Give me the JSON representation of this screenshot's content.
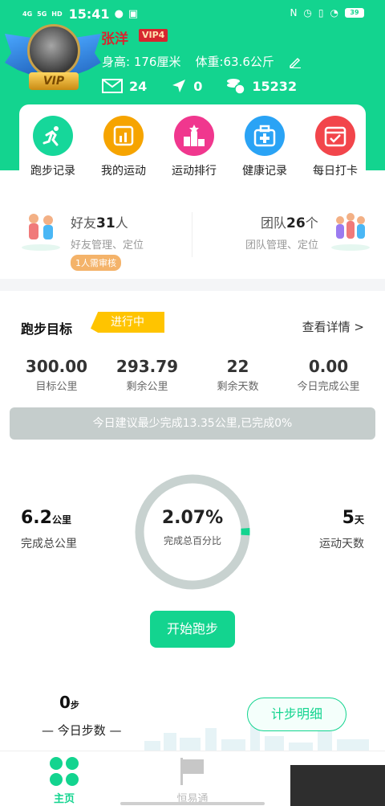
{
  "status_bar": {
    "net1": "4G",
    "net2": "5G",
    "hd": "HD",
    "time": "15:41",
    "battery": "39"
  },
  "profile": {
    "avatar_badge": "VIP",
    "name": "张洋",
    "vip_level": "VIP4",
    "height": "身高: 176厘米",
    "weight": "体重:63.6公斤",
    "messages": "24",
    "location_count": "0",
    "coins": "15232"
  },
  "menu": [
    {
      "label": "跑步记录",
      "color": "#16d79a",
      "icon": "running-icon"
    },
    {
      "label": "我的运动",
      "color": "#f6a400",
      "icon": "chart-icon"
    },
    {
      "label": "运动排行",
      "color": "#f0378e",
      "icon": "podium-icon"
    },
    {
      "label": "健康记录",
      "color": "#2aa3f5",
      "icon": "medkit-icon"
    },
    {
      "label": "每日打卡",
      "color": "#f2454b",
      "icon": "calendar-check-icon"
    }
  ],
  "friends": {
    "label": "好友",
    "count": "31",
    "unit": "人",
    "sub": "好友管理、定位",
    "pending": "1人需审核"
  },
  "team": {
    "label": "团队",
    "count": "26",
    "unit": "个",
    "sub": "团队管理、定位"
  },
  "goal": {
    "title": "跑步目标",
    "status": "进行中",
    "details": "查看详情 >",
    "stats": [
      {
        "value": "300.00",
        "label": "目标公里"
      },
      {
        "value": "293.79",
        "label": "剩余公里"
      },
      {
        "value": "22",
        "label": "剩余天数"
      },
      {
        "value": "0.00",
        "label": "今日完成公里"
      }
    ],
    "suggestion": "今日建议最少完成13.35公里,已完成0%",
    "total_km": "6.2",
    "total_km_unit": "公里",
    "total_km_label": "完成总公里",
    "percent": "2.07%",
    "percent_value": 2.07,
    "percent_label": "完成总百分比",
    "days": "5",
    "days_unit": "天",
    "days_label": "运动天数",
    "start_button": "开始跑步"
  },
  "steps": {
    "value": "0",
    "unit": "步",
    "label": "— 今日步数 —",
    "detail_button": "计步明细"
  },
  "tabbar": {
    "home": "主页",
    "heng": "恒易通"
  },
  "colors": {
    "accent": "#13d48f",
    "ring_track": "#c8d2d0"
  }
}
